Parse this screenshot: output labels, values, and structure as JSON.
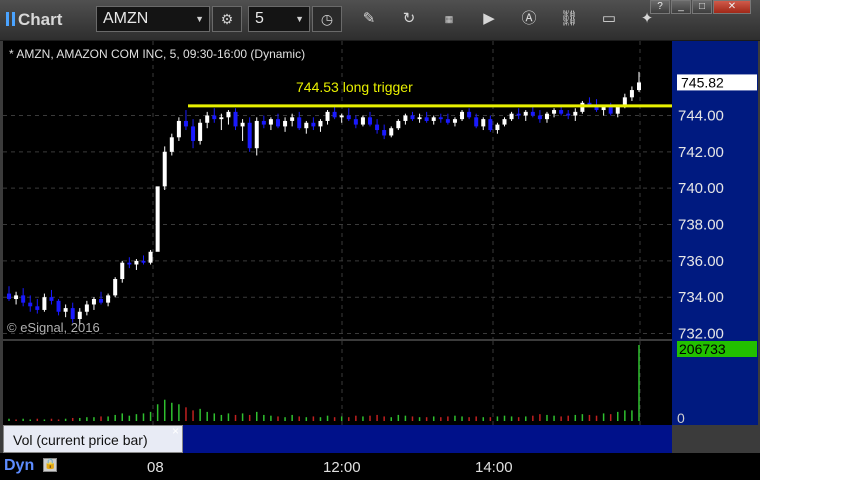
{
  "toolbar": {
    "title": "Chart",
    "symbol": "AMZN",
    "interval": "5"
  },
  "window_controls": [
    "?",
    "_",
    "□",
    "✕"
  ],
  "chart_info": "* AMZN, AMAZON COM INC, 5, 09:30-16:00 (Dynamic)",
  "copyright": "© eSignal, 2016",
  "annotation": "744.53 long trigger",
  "price_label": "745.82",
  "volume_label": "206733",
  "volume_zero": "0",
  "volume_study": "Vol (current price bar)",
  "close_x": "×",
  "dyn_label": "Dyn",
  "colors": {
    "up": "#ffffff",
    "down": "#1a1aff",
    "trigger": "#e8f000",
    "vol_up": "#2fc02f",
    "vol_down": "#c02020",
    "price_tag": "#ffffff",
    "vol_tag": "#22c000"
  },
  "chart_data": {
    "type": "candlestick",
    "y_ticks": [
      "744.00",
      "742.00",
      "740.00",
      "738.00",
      "736.00",
      "734.00",
      "732.00"
    ],
    "ylim": [
      731.7,
      748.1
    ],
    "x_ticks": [
      "08",
      "12:00",
      "14:00"
    ],
    "trigger_level": 744.53,
    "last_price": 745.82,
    "last_volume": 206733,
    "candles": [
      [
        734.2,
        734.6,
        733.8,
        733.9
      ],
      [
        733.9,
        734.3,
        733.6,
        734.1
      ],
      [
        734.1,
        734.5,
        733.5,
        733.7
      ],
      [
        733.7,
        734.1,
        733.2,
        733.5
      ],
      [
        733.5,
        733.9,
        733.1,
        733.3
      ],
      [
        733.3,
        734.2,
        733.2,
        734.0
      ],
      [
        734.0,
        734.4,
        733.6,
        733.8
      ],
      [
        733.8,
        733.9,
        733.0,
        733.2
      ],
      [
        733.2,
        733.6,
        732.9,
        733.4
      ],
      [
        733.4,
        733.7,
        732.6,
        732.8
      ],
      [
        732.8,
        733.4,
        732.5,
        733.2
      ],
      [
        733.2,
        733.8,
        733.0,
        733.6
      ],
      [
        733.6,
        734.0,
        733.3,
        733.9
      ],
      [
        733.9,
        734.3,
        733.6,
        733.7
      ],
      [
        733.7,
        734.2,
        733.5,
        734.1
      ],
      [
        734.1,
        735.1,
        734.0,
        735.0
      ],
      [
        735.0,
        736.0,
        734.8,
        735.9
      ],
      [
        735.9,
        736.2,
        735.6,
        735.8
      ],
      [
        735.8,
        736.1,
        735.5,
        736.0
      ],
      [
        736.0,
        736.3,
        735.8,
        735.9
      ],
      [
        735.9,
        736.6,
        735.8,
        736.5
      ],
      [
        736.5,
        738.4,
        737.8,
        740.1
      ],
      [
        740.1,
        742.3,
        739.9,
        742.0
      ],
      [
        742.0,
        743.0,
        741.8,
        742.8
      ],
      [
        742.8,
        743.9,
        742.6,
        743.7
      ],
      [
        743.7,
        744.3,
        743.2,
        743.4
      ],
      [
        743.4,
        743.8,
        742.2,
        742.6
      ],
      [
        742.6,
        743.8,
        742.4,
        743.6
      ],
      [
        743.6,
        744.2,
        743.3,
        744.0
      ],
      [
        744.0,
        744.4,
        743.6,
        743.8
      ],
      [
        743.8,
        744.1,
        743.2,
        743.9
      ],
      [
        743.9,
        744.3,
        743.5,
        744.2
      ],
      [
        744.2,
        744.4,
        743.2,
        743.4
      ],
      [
        743.4,
        743.8,
        742.6,
        743.6
      ],
      [
        743.6,
        743.9,
        742.0,
        742.2
      ],
      [
        742.2,
        743.9,
        741.8,
        743.7
      ],
      [
        743.7,
        744.0,
        743.3,
        743.5
      ],
      [
        743.5,
        743.9,
        743.2,
        743.8
      ],
      [
        743.8,
        744.1,
        743.3,
        743.4
      ],
      [
        743.4,
        743.9,
        743.1,
        743.7
      ],
      [
        743.7,
        744.1,
        743.4,
        743.9
      ],
      [
        743.9,
        744.2,
        743.2,
        743.3
      ],
      [
        743.3,
        743.7,
        743.0,
        743.6
      ],
      [
        743.6,
        743.9,
        743.2,
        743.4
      ],
      [
        743.4,
        743.8,
        743.1,
        743.7
      ],
      [
        743.7,
        744.3,
        743.5,
        744.2
      ],
      [
        744.2,
        744.5,
        743.8,
        743.9
      ],
      [
        743.9,
        744.1,
        743.6,
        744.0
      ],
      [
        744.0,
        744.4,
        743.7,
        743.8
      ],
      [
        743.8,
        744.0,
        743.3,
        743.5
      ],
      [
        743.5,
        744.0,
        743.4,
        743.9
      ],
      [
        743.9,
        744.2,
        743.4,
        743.5
      ],
      [
        743.5,
        743.8,
        743.0,
        743.2
      ],
      [
        743.2,
        743.5,
        742.7,
        742.9
      ],
      [
        742.9,
        743.4,
        742.8,
        743.3
      ],
      [
        743.3,
        743.8,
        743.2,
        743.7
      ],
      [
        743.7,
        744.1,
        743.5,
        744.0
      ],
      [
        744.0,
        744.2,
        743.7,
        743.8
      ],
      [
        743.8,
        744.1,
        743.6,
        743.9
      ],
      [
        743.9,
        744.2,
        743.6,
        743.7
      ],
      [
        743.7,
        744.0,
        743.5,
        743.9
      ],
      [
        743.9,
        744.1,
        743.6,
        743.8
      ],
      [
        743.8,
        744.1,
        743.5,
        743.6
      ],
      [
        743.6,
        743.9,
        743.4,
        743.8
      ],
      [
        743.8,
        744.3,
        743.7,
        744.2
      ],
      [
        744.2,
        744.4,
        743.8,
        743.9
      ],
      [
        743.9,
        744.1,
        743.3,
        743.4
      ],
      [
        743.4,
        743.9,
        743.2,
        743.8
      ],
      [
        743.8,
        744.0,
        743.1,
        743.2
      ],
      [
        743.2,
        743.6,
        743.0,
        743.5
      ],
      [
        743.5,
        743.9,
        743.4,
        743.8
      ],
      [
        743.8,
        744.2,
        743.7,
        744.1
      ],
      [
        744.1,
        744.4,
        743.8,
        744.0
      ],
      [
        744.0,
        744.3,
        743.7,
        744.2
      ],
      [
        744.2,
        744.5,
        743.9,
        744.0
      ],
      [
        744.0,
        744.3,
        743.6,
        743.8
      ],
      [
        743.8,
        744.2,
        743.6,
        744.1
      ],
      [
        744.1,
        744.4,
        743.9,
        744.3
      ],
      [
        744.3,
        744.6,
        744.0,
        744.1
      ],
      [
        744.1,
        744.3,
        743.8,
        744.0
      ],
      [
        744.0,
        744.4,
        743.7,
        744.2
      ],
      [
        744.2,
        744.8,
        744.1,
        744.7
      ],
      [
        744.7,
        745.0,
        744.5,
        744.6
      ],
      [
        744.6,
        744.9,
        744.2,
        744.3
      ],
      [
        744.3,
        744.6,
        744.0,
        744.5
      ],
      [
        744.5,
        744.7,
        744.0,
        744.1
      ],
      [
        744.1,
        744.6,
        743.9,
        744.5
      ],
      [
        744.5,
        745.2,
        744.4,
        745.0
      ],
      [
        745.0,
        745.6,
        744.8,
        745.4
      ],
      [
        745.4,
        746.4,
        745.3,
        745.82
      ]
    ],
    "volume_max": 206733,
    "volumes": [
      [
        0.03,
        1
      ],
      [
        0.02,
        0
      ],
      [
        0.03,
        1
      ],
      [
        0.02,
        1
      ],
      [
        0.03,
        0
      ],
      [
        0.02,
        1
      ],
      [
        0.03,
        0
      ],
      [
        0.02,
        0
      ],
      [
        0.03,
        1
      ],
      [
        0.04,
        0
      ],
      [
        0.04,
        1
      ],
      [
        0.05,
        1
      ],
      [
        0.05,
        1
      ],
      [
        0.06,
        0
      ],
      [
        0.06,
        1
      ],
      [
        0.08,
        1
      ],
      [
        0.1,
        1
      ],
      [
        0.07,
        1
      ],
      [
        0.09,
        1
      ],
      [
        0.1,
        1
      ],
      [
        0.12,
        1
      ],
      [
        0.22,
        1
      ],
      [
        0.28,
        1
      ],
      [
        0.24,
        1
      ],
      [
        0.22,
        1
      ],
      [
        0.18,
        0
      ],
      [
        0.14,
        0
      ],
      [
        0.16,
        1
      ],
      [
        0.12,
        1
      ],
      [
        0.1,
        1
      ],
      [
        0.08,
        1
      ],
      [
        0.1,
        1
      ],
      [
        0.08,
        0
      ],
      [
        0.1,
        1
      ],
      [
        0.08,
        0
      ],
      [
        0.12,
        1
      ],
      [
        0.08,
        1
      ],
      [
        0.07,
        1
      ],
      [
        0.06,
        0
      ],
      [
        0.05,
        1
      ],
      [
        0.08,
        1
      ],
      [
        0.06,
        0
      ],
      [
        0.05,
        1
      ],
      [
        0.06,
        0
      ],
      [
        0.05,
        1
      ],
      [
        0.07,
        1
      ],
      [
        0.05,
        0
      ],
      [
        0.06,
        1
      ],
      [
        0.05,
        0
      ],
      [
        0.07,
        0
      ],
      [
        0.06,
        1
      ],
      [
        0.07,
        0
      ],
      [
        0.08,
        0
      ],
      [
        0.06,
        0
      ],
      [
        0.05,
        1
      ],
      [
        0.08,
        1
      ],
      [
        0.07,
        1
      ],
      [
        0.06,
        0
      ],
      [
        0.05,
        1
      ],
      [
        0.05,
        0
      ],
      [
        0.06,
        1
      ],
      [
        0.05,
        0
      ],
      [
        0.06,
        0
      ],
      [
        0.07,
        1
      ],
      [
        0.06,
        1
      ],
      [
        0.05,
        0
      ],
      [
        0.06,
        0
      ],
      [
        0.05,
        1
      ],
      [
        0.05,
        0
      ],
      [
        0.06,
        1
      ],
      [
        0.07,
        1
      ],
      [
        0.06,
        1
      ],
      [
        0.05,
        0
      ],
      [
        0.06,
        1
      ],
      [
        0.07,
        0
      ],
      [
        0.09,
        0
      ],
      [
        0.08,
        1
      ],
      [
        0.07,
        1
      ],
      [
        0.06,
        0
      ],
      [
        0.07,
        0
      ],
      [
        0.08,
        1
      ],
      [
        0.09,
        1
      ],
      [
        0.08,
        0
      ],
      [
        0.07,
        0
      ],
      [
        0.1,
        1
      ],
      [
        0.09,
        0
      ],
      [
        0.12,
        1
      ],
      [
        0.14,
        1
      ],
      [
        0.14,
        1
      ],
      [
        1.0,
        1
      ]
    ]
  }
}
